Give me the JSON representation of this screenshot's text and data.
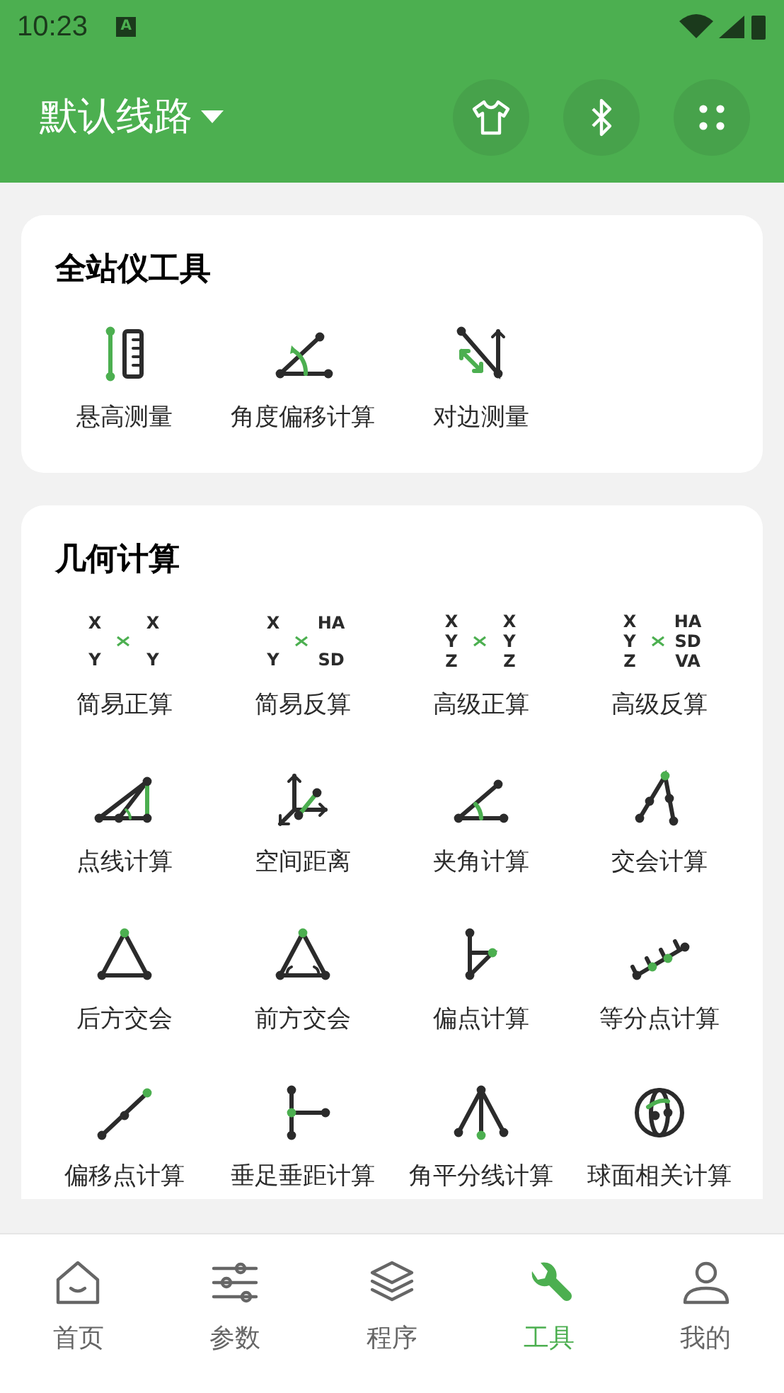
{
  "status_bar": {
    "time": "10:23",
    "notice": "A"
  },
  "app_bar": {
    "title": "默认线路",
    "actions": [
      {
        "kind": "shirt"
      },
      {
        "kind": "bluetooth"
      },
      {
        "kind": "scan"
      }
    ]
  },
  "sections": [
    {
      "title": "全站仪工具",
      "tools": [
        {
          "label": "悬高测量",
          "kind": "ruler"
        },
        {
          "label": "角度偏移计算",
          "kind": "angleshift"
        },
        {
          "label": "对边测量",
          "kind": "opposite"
        }
      ]
    },
    {
      "title": "几何计算",
      "tools": [
        {
          "label": "简易正算",
          "kind": "coords",
          "left": [
            "X",
            "Y"
          ],
          "right": [
            "X",
            "Y"
          ]
        },
        {
          "label": "简易反算",
          "kind": "coords",
          "left": [
            "X",
            "Y"
          ],
          "right": [
            "HA",
            "SD"
          ]
        },
        {
          "label": "高级正算",
          "kind": "coords",
          "left": [
            "X",
            "Y",
            "Z"
          ],
          "right": [
            "X",
            "Y",
            "Z"
          ]
        },
        {
          "label": "高级反算",
          "kind": "coords",
          "left": [
            "X",
            "Y",
            "Z"
          ],
          "right": [
            "HA",
            "SD",
            "VA"
          ]
        },
        {
          "label": "点线计算",
          "kind": "pointline"
        },
        {
          "label": "空间距离",
          "kind": "space"
        },
        {
          "label": "夹角计算",
          "kind": "angle"
        },
        {
          "label": "交会计算",
          "kind": "intersect"
        },
        {
          "label": "后方交会",
          "kind": "resection"
        },
        {
          "label": "前方交会",
          "kind": "forward"
        },
        {
          "label": "偏点计算",
          "kind": "offset"
        },
        {
          "label": "等分点计算",
          "kind": "divide"
        },
        {
          "label": "偏移点计算",
          "kind": "shiftpoint"
        },
        {
          "label": "垂足垂距计算",
          "kind": "foot"
        },
        {
          "label": "角平分线计算",
          "kind": "bisector"
        },
        {
          "label": "球面相关计算",
          "kind": "sphere"
        }
      ]
    }
  ],
  "nav": [
    {
      "label": "首页",
      "kind": "home",
      "selected": false
    },
    {
      "label": "参数",
      "kind": "sliders",
      "selected": false
    },
    {
      "label": "程序",
      "kind": "layers",
      "selected": false
    },
    {
      "label": "工具",
      "kind": "wrench",
      "selected": true
    },
    {
      "label": "我的",
      "kind": "user",
      "selected": false
    }
  ]
}
